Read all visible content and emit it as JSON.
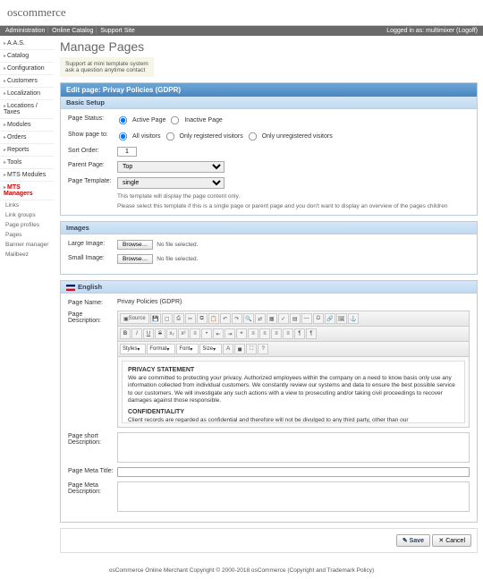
{
  "logo": "oscommerce",
  "topnav": {
    "items": [
      "Administration",
      "Online Catalog",
      "Support Site"
    ],
    "login": "Logged in as: multimixer (Logoff)"
  },
  "sidebar": {
    "items": [
      "A.A.S.",
      "Catalog",
      "Configuration",
      "Customers",
      "Localization",
      "Locations / Taxes",
      "Modules",
      "Orders",
      "Reports",
      "Tools",
      "MTS Modules",
      "MTS Managers"
    ],
    "active": 11,
    "sub": [
      "Links",
      "Link groups",
      "Page profiles",
      "Pages",
      "Banner manager",
      "Mailbeez"
    ]
  },
  "page": {
    "title": "Manage Pages",
    "note1": "Support at mini template system",
    "note2": "ask a question anytime contact",
    "panel_title": "Edit page: Privay Policies (GDPR)"
  },
  "basic": {
    "title": "Basic Setup",
    "status": {
      "label": "Page Status:",
      "opt1": "Active Page",
      "opt2": "Inactive Page"
    },
    "show": {
      "label": "Show page to:",
      "opt1": "All visitors",
      "opt2": "Only registered visitors",
      "opt3": "Only unregistered visitors"
    },
    "sort": {
      "label": "Sort Order:",
      "value": "1"
    },
    "parent": {
      "label": "Parent Page:",
      "value": "Top"
    },
    "template": {
      "label": "Page Template:",
      "value": "single"
    },
    "hint1": "This template will display the page content only.",
    "hint2": "Please select this template if this is a single page or parent page and you don't want to display an overview of the pages children"
  },
  "images": {
    "title": "Images",
    "large": "Large Image:",
    "small": "Small Image:",
    "browse": "Browse…",
    "nofile": "No file selected."
  },
  "english": {
    "title": "English",
    "name": {
      "label": "Page Name:",
      "value": "Privay Policies (GDPR)"
    },
    "desc_label": "Page Description:",
    "editor": {
      "source": "Source",
      "styles": "Styles",
      "format": "Format",
      "font": "Font",
      "size": "Size",
      "h1": "PRIVACY STATEMENT",
      "p1": "We are committed to protecting your privacy. Authorized employees within the company on a need to know basis only use any information collected from individual customers. We constantly review our systems and data to ensure the best possible service to our customers. We will investigate any such actions with a view to prosecuting and/or taking civil proceedings to recover damages against those responsible.",
      "h2": "CONFIDENTIALITY",
      "p2": "Client records are regarded as confidential and therefore will not be divulged to any third party, other than our manufacturer/supplier(s) and if legally required to do so to the appropriate authorities. Clients have the right to request sight of, and copies of any and all Client Records we keep, on the provison that we are given reasonable notice of such a request. Clients are requested to retain copies of any literature issued in relation to the provision of our services."
    },
    "short_label": "Page short Description:",
    "meta_title_label": "Page Meta Title:",
    "meta_desc_label": "Page Meta Description:"
  },
  "actions": {
    "save": "Save",
    "cancel": "Cancel"
  },
  "footer": "osCommerce Online Merchant Copyright © 2000-2018 osCommerce (Copyright and Trademark Policy)"
}
